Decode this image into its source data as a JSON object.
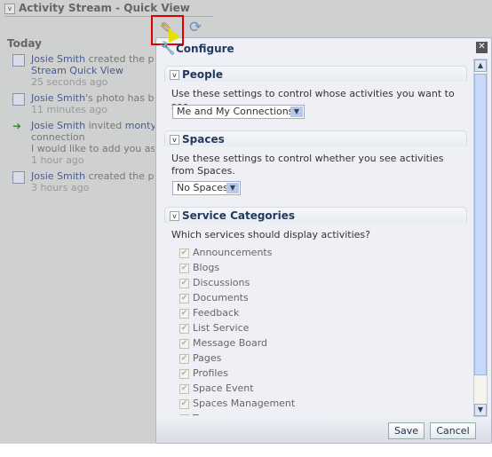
{
  "header": {
    "title": "Activity Stream - Quick View",
    "toggle_icon": "chevron-down-icon"
  },
  "stream": {
    "section": "Today",
    "items": [
      {
        "icon": "page-icon",
        "actor": "Josie Smith",
        "text": " created the page",
        "line2": "Stream Quick View",
        "time": "25 seconds ago"
      },
      {
        "icon": "photo-icon",
        "actor": "Josie Smith",
        "text": "'s photo has been",
        "time": "11 minutes ago"
      },
      {
        "icon": "invite-icon",
        "actor": "Josie Smith",
        "text": " invited ",
        "target": "monty coi",
        "line2": "connection",
        "line3": "I would like to add you as my",
        "time": "1 hour ago"
      },
      {
        "icon": "page-icon",
        "actor": "Josie Smith",
        "text": " created the page",
        "time": "3 hours ago"
      }
    ]
  },
  "toolbar": {
    "edit_icon": "pencil-icon",
    "refresh_icon": "refresh-icon"
  },
  "dialog": {
    "title": "Configure",
    "people": {
      "label": "People",
      "description": "Use these settings to control whose activities you want to see.",
      "selected": "Me and My Connections"
    },
    "spaces": {
      "label": "Spaces",
      "description": "Use these settings to control whether you see activities from Spaces.",
      "selected": "No Spaces"
    },
    "services": {
      "label": "Service Categories",
      "description": "Which services should display activities?",
      "items": [
        {
          "label": "Announcements",
          "checked": true
        },
        {
          "label": "Blogs",
          "checked": true
        },
        {
          "label": "Discussions",
          "checked": true
        },
        {
          "label": "Documents",
          "checked": true
        },
        {
          "label": "Feedback",
          "checked": true
        },
        {
          "label": "List Service",
          "checked": true
        },
        {
          "label": "Message Board",
          "checked": true
        },
        {
          "label": "Pages",
          "checked": true
        },
        {
          "label": "Profiles",
          "checked": true
        },
        {
          "label": "Space Event",
          "checked": true
        },
        {
          "label": "Spaces Management",
          "checked": true
        },
        {
          "label": "Tags",
          "checked": true
        }
      ]
    },
    "save": "Save",
    "cancel": "Cancel"
  },
  "colors": {
    "accent": "#1f3a5e",
    "link": "#4a5a90",
    "highlight": "#e00000"
  }
}
